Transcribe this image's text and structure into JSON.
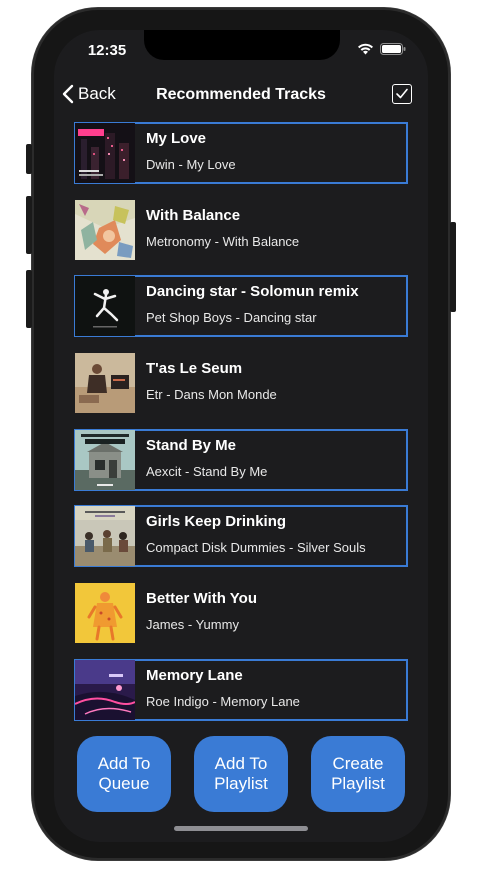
{
  "status_bar": {
    "time": "12:35"
  },
  "nav": {
    "back_label": "Back",
    "title": "Recommended Tracks"
  },
  "tracks": [
    {
      "title": "My Love",
      "subtitle": "Dwin - My Love",
      "selected": true,
      "art": "pink-text-cover"
    },
    {
      "title": "With Balance",
      "subtitle": "Metronomy - With Balance",
      "selected": false,
      "art": "collage-cover"
    },
    {
      "title": "Dancing star - Solomun remix",
      "subtitle": "Pet Shop Boys - Dancing star",
      "selected": true,
      "art": "dancer-cover"
    },
    {
      "title": "T'as Le Seum",
      "subtitle": "Etr - Dans Mon Monde",
      "selected": false,
      "art": "room-photo-cover"
    },
    {
      "title": "Stand By Me",
      "subtitle": "Aexcit - Stand By Me",
      "selected": true,
      "art": "house-cover"
    },
    {
      "title": "Girls Keep Drinking",
      "subtitle": "Compact Disk Dummies - Silver Souls",
      "selected": true,
      "art": "band-photo-cover"
    },
    {
      "title": "Better With You",
      "subtitle": "James - Yummy",
      "selected": false,
      "art": "yellow-figure-cover"
    },
    {
      "title": "Memory Lane",
      "subtitle": "Roe Indigo - Memory Lane",
      "selected": true,
      "art": "neon-city-cover"
    }
  ],
  "actions": {
    "add_to_queue": "Add To\nQueue",
    "add_to_playlist": "Add To\nPlaylist",
    "create_playlist": "Create\nPlaylist"
  },
  "colors": {
    "accent": "#3a7bd5",
    "background": "#1c1c1e",
    "text": "#ffffff"
  }
}
